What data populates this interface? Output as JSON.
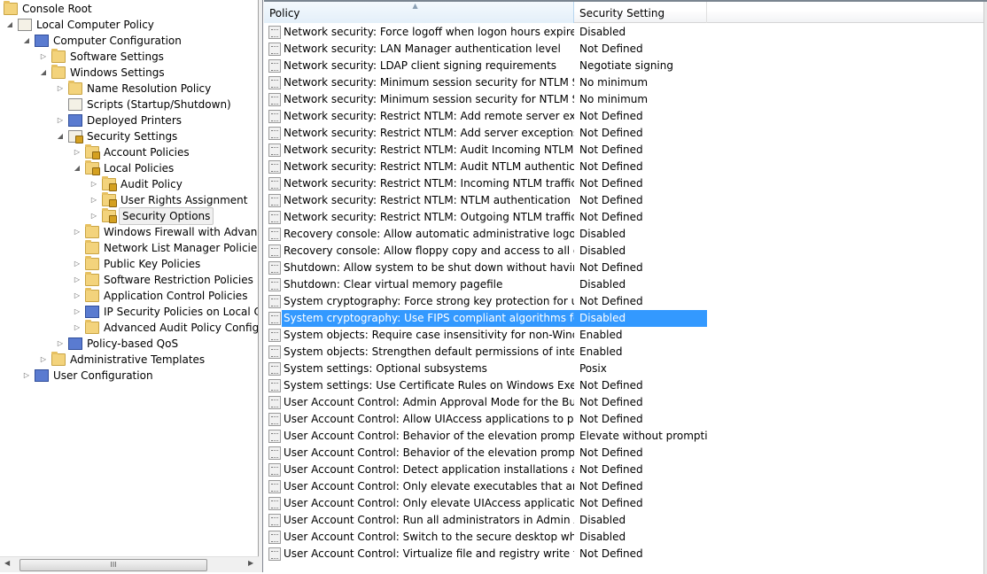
{
  "tree": [
    {
      "label": "Console Root",
      "level": 0,
      "arrow": "",
      "icon": "folder"
    },
    {
      "label": "Local Computer Policy",
      "level": 1,
      "arrow": "expanded",
      "icon": "doc"
    },
    {
      "label": "Computer Configuration",
      "level": 2,
      "arrow": "expanded",
      "icon": "comp"
    },
    {
      "label": "Software Settings",
      "level": 3,
      "arrow": "collapsed",
      "icon": "folder"
    },
    {
      "label": "Windows Settings",
      "level": 3,
      "arrow": "expanded",
      "icon": "folder"
    },
    {
      "label": "Name Resolution Policy",
      "level": 4,
      "arrow": "collapsed",
      "icon": "folder"
    },
    {
      "label": "Scripts (Startup/Shutdown)",
      "level": 4,
      "arrow": "",
      "icon": "doc"
    },
    {
      "label": "Deployed Printers",
      "level": 4,
      "arrow": "collapsed",
      "icon": "comp"
    },
    {
      "label": "Security Settings",
      "level": 4,
      "arrow": "expanded",
      "icon": "doc lock"
    },
    {
      "label": "Account Policies",
      "level": 5,
      "arrow": "collapsed",
      "icon": "folder lock"
    },
    {
      "label": "Local Policies",
      "level": 5,
      "arrow": "expanded",
      "icon": "folder lock"
    },
    {
      "label": "Audit Policy",
      "level": 6,
      "arrow": "collapsed",
      "icon": "folder lock"
    },
    {
      "label": "User Rights Assignment",
      "level": 6,
      "arrow": "collapsed",
      "icon": "folder lock"
    },
    {
      "label": "Security Options",
      "level": 6,
      "arrow": "collapsed",
      "icon": "folder lock",
      "selected": true
    },
    {
      "label": "Windows Firewall with Advanced Security",
      "level": 5,
      "arrow": "collapsed",
      "icon": "folder"
    },
    {
      "label": "Network List Manager Policies",
      "level": 5,
      "arrow": "",
      "icon": "folder"
    },
    {
      "label": "Public Key Policies",
      "level": 5,
      "arrow": "collapsed",
      "icon": "folder"
    },
    {
      "label": "Software Restriction Policies",
      "level": 5,
      "arrow": "collapsed",
      "icon": "folder"
    },
    {
      "label": "Application Control Policies",
      "level": 5,
      "arrow": "collapsed",
      "icon": "folder"
    },
    {
      "label": "IP Security Policies on Local Computer",
      "level": 5,
      "arrow": "collapsed",
      "icon": "comp"
    },
    {
      "label": "Advanced Audit Policy Configuration",
      "level": 5,
      "arrow": "collapsed",
      "icon": "folder"
    },
    {
      "label": "Policy-based QoS",
      "level": 4,
      "arrow": "collapsed",
      "icon": "comp"
    },
    {
      "label": "Administrative Templates",
      "level": 3,
      "arrow": "collapsed",
      "icon": "folder"
    },
    {
      "label": "User Configuration",
      "level": 2,
      "arrow": "collapsed",
      "icon": "comp"
    }
  ],
  "hscroll_grip": "III",
  "columns": {
    "policy": "Policy",
    "setting": "Security Setting"
  },
  "rows": [
    {
      "policy": "Network security: Force logoff when logon hours expire",
      "setting": "Disabled"
    },
    {
      "policy": "Network security: LAN Manager authentication level",
      "setting": "Not Defined"
    },
    {
      "policy": "Network security: LDAP client signing requirements",
      "setting": "Negotiate signing"
    },
    {
      "policy": "Network security: Minimum session security for NTLM SSP ...",
      "setting": "No minimum"
    },
    {
      "policy": "Network security: Minimum session security for NTLM SSP ...",
      "setting": "No minimum"
    },
    {
      "policy": "Network security: Restrict NTLM: Add remote server excepti...",
      "setting": "Not Defined"
    },
    {
      "policy": "Network security: Restrict NTLM: Add server exceptions in t...",
      "setting": "Not Defined"
    },
    {
      "policy": "Network security: Restrict NTLM: Audit Incoming NTLM Tra...",
      "setting": "Not Defined"
    },
    {
      "policy": "Network security: Restrict NTLM: Audit NTLM authenticatio...",
      "setting": "Not Defined"
    },
    {
      "policy": "Network security: Restrict NTLM: Incoming NTLM traffic",
      "setting": "Not Defined"
    },
    {
      "policy": "Network security: Restrict NTLM: NTLM authentication in th...",
      "setting": "Not Defined"
    },
    {
      "policy": "Network security: Restrict NTLM: Outgoing NTLM traffic to ...",
      "setting": "Not Defined"
    },
    {
      "policy": "Recovery console: Allow automatic administrative logon",
      "setting": "Disabled"
    },
    {
      "policy": "Recovery console: Allow floppy copy and access to all drives...",
      "setting": "Disabled"
    },
    {
      "policy": "Shutdown: Allow system to be shut down without having to...",
      "setting": "Not Defined"
    },
    {
      "policy": "Shutdown: Clear virtual memory pagefile",
      "setting": "Disabled"
    },
    {
      "policy": "System cryptography: Force strong key protection for user k...",
      "setting": "Not Defined"
    },
    {
      "policy": "System cryptography: Use FIPS compliant algorithms for en...",
      "setting": "Disabled",
      "selected": true
    },
    {
      "policy": "System objects: Require case insensitivity for non-Windows ...",
      "setting": "Enabled"
    },
    {
      "policy": "System objects: Strengthen default permissions of internal s...",
      "setting": "Enabled"
    },
    {
      "policy": "System settings: Optional subsystems",
      "setting": "Posix"
    },
    {
      "policy": "System settings: Use Certificate Rules on Windows Executabl...",
      "setting": "Not Defined"
    },
    {
      "policy": "User Account Control: Admin Approval Mode for the Built-i...",
      "setting": "Not Defined"
    },
    {
      "policy": "User Account Control: Allow UIAccess applications to prom...",
      "setting": "Not Defined"
    },
    {
      "policy": "User Account Control: Behavior of the elevation prompt for ...",
      "setting": "Elevate without prompti..."
    },
    {
      "policy": "User Account Control: Behavior of the elevation prompt for ...",
      "setting": "Not Defined"
    },
    {
      "policy": "User Account Control: Detect application installations and p...",
      "setting": "Not Defined"
    },
    {
      "policy": "User Account Control: Only elevate executables that are sign...",
      "setting": "Not Defined"
    },
    {
      "policy": "User Account Control: Only elevate UIAccess applications th...",
      "setting": "Not Defined"
    },
    {
      "policy": "User Account Control: Run all administrators in Admin Appr...",
      "setting": "Disabled"
    },
    {
      "policy": "User Account Control: Switch to the secure desktop when pr...",
      "setting": "Disabled"
    },
    {
      "policy": "User Account Control: Virtualize file and registry write failure...",
      "setting": "Not Defined"
    }
  ],
  "colors": {
    "selection": "#3399ff"
  }
}
